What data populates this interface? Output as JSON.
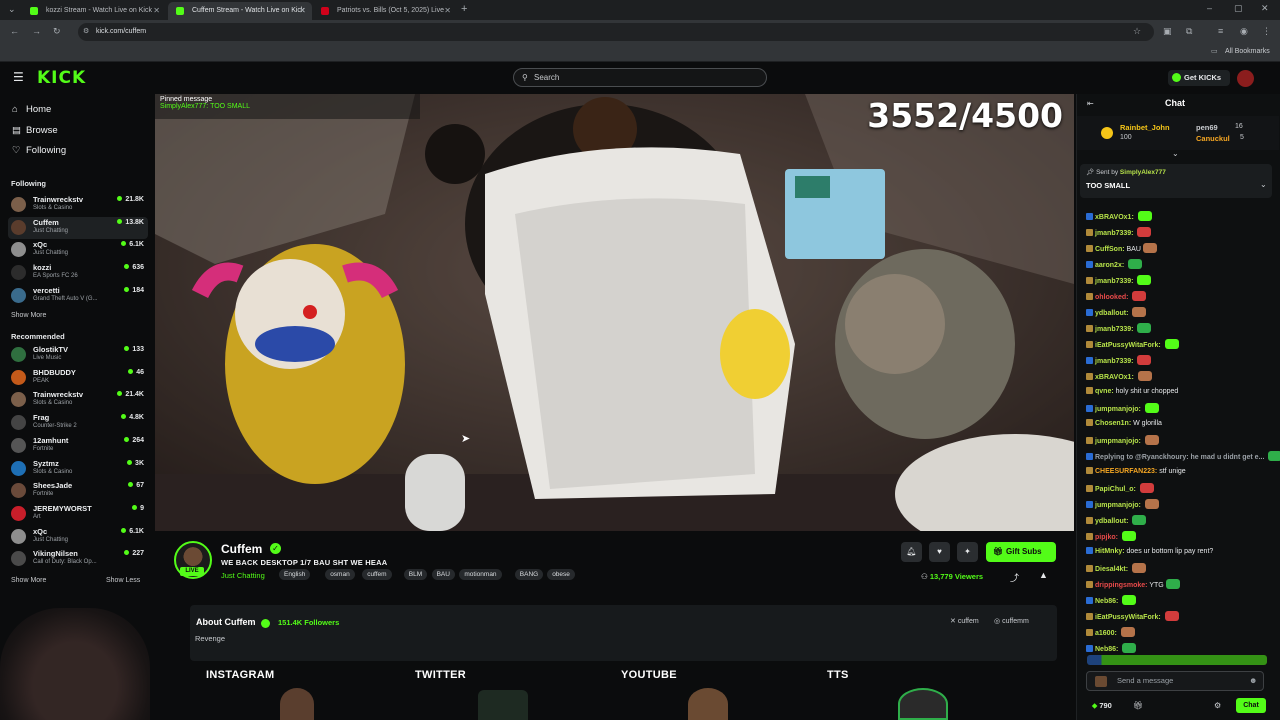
{
  "browser": {
    "tabs": [
      {
        "title": "kozzi Stream - Watch Live on Kick",
        "color": "#53fc18"
      },
      {
        "title": "Cuffem Stream - Watch Live on Kick",
        "color": "#53fc18"
      },
      {
        "title": "Patriots vs. Bills (Oct 5, 2025) Live",
        "color": "#d0021b"
      }
    ],
    "url": "kick.com/cuffem",
    "bookmarks_label": "All Bookmarks"
  },
  "header": {
    "logo": "KICK",
    "search_placeholder": "Search",
    "get_kicks": "Get KICKs"
  },
  "sidebar": {
    "nav": [
      {
        "label": "Home",
        "icon": "home-icon"
      },
      {
        "label": "Browse",
        "icon": "browse-icon"
      },
      {
        "label": "Following",
        "icon": "heart-icon"
      }
    ],
    "following_title": "Following",
    "following": [
      {
        "name": "Trainwreckstv",
        "category": "Slots & Casino",
        "viewers": "21.8K",
        "color": "#7b5f4a"
      },
      {
        "name": "Cuffem",
        "category": "Just Chatting",
        "viewers": "13.8K",
        "color": "#5a3c2c"
      },
      {
        "name": "xQc",
        "category": "Just Chatting",
        "viewers": "6.1K",
        "color": "#8e8e8e"
      },
      {
        "name": "kozzi",
        "category": "EA Sports FC 26",
        "viewers": "636",
        "color": "#2c2c2c"
      },
      {
        "name": "vercetti",
        "category": "Grand Theft Auto V (G...",
        "viewers": "184",
        "color": "#3a6b8c"
      }
    ],
    "show_more": "Show More",
    "recommended_title": "Recommended",
    "recommended": [
      {
        "name": "GlostikTV",
        "category": "Live Music",
        "viewers": "133",
        "color": "#2f6f3f"
      },
      {
        "name": "BHDBUDDY",
        "category": "PEAK",
        "viewers": "46",
        "color": "#c45a1a"
      },
      {
        "name": "Trainwreckstv",
        "category": "Slots & Casino",
        "viewers": "21.4K",
        "color": "#7b5f4a"
      },
      {
        "name": "Frag",
        "category": "Counter-Strike 2",
        "viewers": "4.8K",
        "color": "#444"
      },
      {
        "name": "12amhunt",
        "category": "Fortnite",
        "viewers": "264",
        "color": "#555"
      },
      {
        "name": "Syztmz",
        "category": "Slots & Casino",
        "viewers": "3K",
        "color": "#1e6fb5"
      },
      {
        "name": "SheesJade",
        "category": "Fortnite",
        "viewers": "67",
        "color": "#6a4a3a"
      },
      {
        "name": "JEREMYWORST",
        "category": "Art",
        "viewers": "9",
        "color": "#c81e2a"
      },
      {
        "name": "xQc",
        "category": "Just Chatting",
        "viewers": "6.1K",
        "color": "#8e8e8e"
      },
      {
        "name": "VikingNilsen",
        "category": "Call of Duty: Black Op...",
        "viewers": "227",
        "color": "#4a4a4a"
      }
    ],
    "show_more_2": "Show More",
    "show_less": "Show Less"
  },
  "video": {
    "overlay_counter": "3552/4500",
    "pinned_label": "Pinned message",
    "pinned_text": "SimplyAlex777: TOO SMALL"
  },
  "stream": {
    "name": "Cuffem",
    "live": "LIVE",
    "title": "WE BACK DESKTOP 1/7 BAU SHT WE HEAA",
    "category": "Just Chatting",
    "tags": [
      "English",
      "osman",
      "cuffem",
      "BLM",
      "BAU",
      "motionman",
      "BANG",
      "obese"
    ],
    "gift_subs": "Gift Subs",
    "viewers": "13,779 Viewers"
  },
  "about": {
    "title": "About Cuffem",
    "followers": "151.4K Followers",
    "subtitle": "Revenge",
    "x_handle": "cuffem",
    "ig_handle": "cuffemm",
    "panels": [
      "INSTAGRAM",
      "TWITTER",
      "YOUTUBE",
      "TTS"
    ]
  },
  "chat": {
    "title": "Chat",
    "leaders": [
      {
        "name": "Rainbet_John",
        "value": "100"
      },
      {
        "name": "pen69",
        "value": "16"
      },
      {
        "name": "Canuckul",
        "value": "5"
      }
    ],
    "pinned_sent_by": "Sent by",
    "pinned_user": "SimplyAlex777",
    "pinned_msg": "TOO SMALL",
    "messages": [
      {
        "user": "xBRAVOx1:",
        "text": "",
        "color": "#b7e34a"
      },
      {
        "user": "jmanb7339:",
        "text": "",
        "color": "#b7e34a"
      },
      {
        "user": "CuffSon:",
        "text": "BAU",
        "color": "#b7e34a"
      },
      {
        "user": "aaron2x:",
        "text": "",
        "color": "#b7e34a"
      },
      {
        "user": "jmanb7339:",
        "text": "",
        "color": "#b7e34a"
      },
      {
        "user": "ohlooked:",
        "text": "",
        "color": "#e84a4a"
      },
      {
        "user": "ydballout:",
        "text": "",
        "color": "#b7e34a"
      },
      {
        "user": "jmanb7339:",
        "text": "",
        "color": "#b7e34a"
      },
      {
        "user": "iEatPussyWitaFork:",
        "text": "",
        "color": "#b7e34a"
      },
      {
        "user": "jmanb7339:",
        "text": "",
        "color": "#b7e34a"
      },
      {
        "user": "xBRAVOx1:",
        "text": "",
        "color": "#b7e34a"
      },
      {
        "user": "qvne:",
        "text": "holy shit ur chopped",
        "color": "#b7e34a"
      },
      {
        "user": "jumpmanjojo:",
        "text": "",
        "color": "#b7e34a"
      },
      {
        "user": "Chosen1n:",
        "text": "W glorilla",
        "color": "#b7e34a"
      },
      {
        "user": "jumpmanjojo:",
        "text": "",
        "color": "#b7e34a"
      },
      {
        "user": "Replying to @Ryanckhoury: he mad u didnt get e...",
        "text": "",
        "color": "#9aa0a6"
      },
      {
        "user": "CHEESURFAN223:",
        "text": "stf unige",
        "color": "#f5a623"
      },
      {
        "user": "PapiChul_o:",
        "text": "",
        "color": "#b7e34a"
      },
      {
        "user": "jumpmanjojo:",
        "text": "",
        "color": "#b7e34a"
      },
      {
        "user": "ydballout:",
        "text": "",
        "color": "#b7e34a"
      },
      {
        "user": "pipjko:",
        "text": "",
        "color": "#e84a4a"
      },
      {
        "user": "HitMnky:",
        "text": "does ur bottom lip pay rent?",
        "color": "#b7e34a"
      },
      {
        "user": "Diesal4kt:",
        "text": "",
        "color": "#b7e34a"
      },
      {
        "user": "drippingsmoke:",
        "text": "YTG",
        "color": "#e84a4a"
      },
      {
        "user": "Neb86:",
        "text": "",
        "color": "#b7e34a"
      },
      {
        "user": "iEatPussyWitaFork:",
        "text": "",
        "color": "#b7e34a"
      },
      {
        "user": "a1600:",
        "text": "",
        "color": "#b7e34a"
      },
      {
        "user": "Neb86:",
        "text": "",
        "color": "#b7e34a"
      }
    ],
    "input_placeholder": "Send a message",
    "points": "790",
    "chat_button": "Chat"
  },
  "colors": {
    "accent": "#53fc18",
    "background": "#0b0c0d"
  }
}
